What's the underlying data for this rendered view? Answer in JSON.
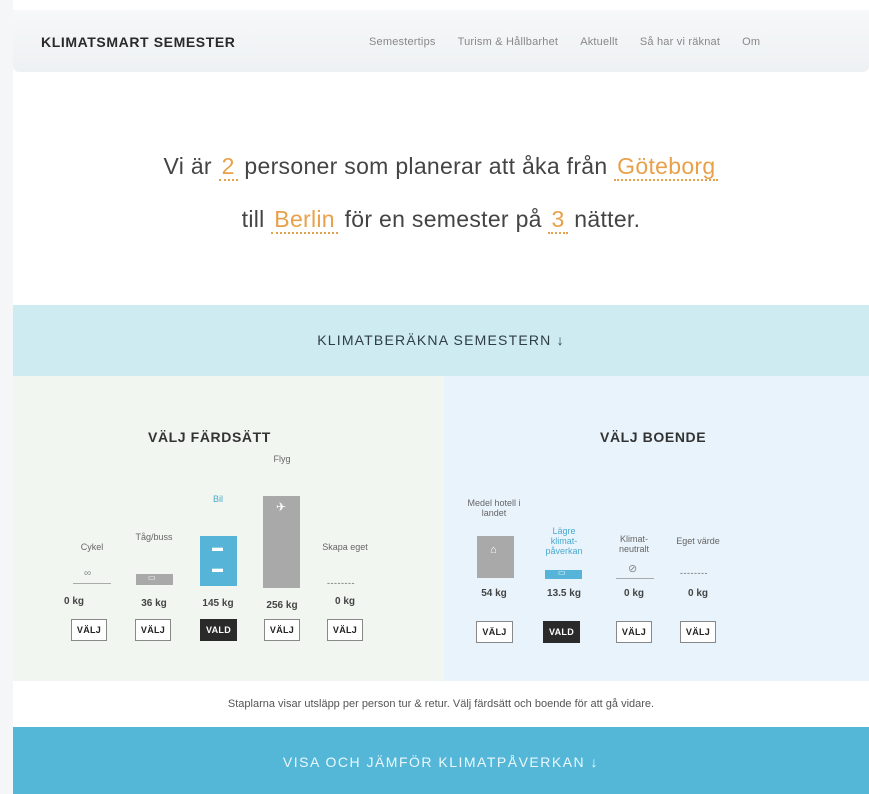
{
  "header": {
    "logo": "KLIMATSMART SEMESTER",
    "nav": [
      "Semestertips",
      "Turism & Hållbarhet",
      "Aktuellt",
      "Så har vi räknat",
      "Om"
    ]
  },
  "hero": {
    "part1": "Vi är",
    "persons": "2",
    "part2": "personer som planerar att åka från",
    "from": "Göteborg",
    "part3": "till",
    "to": "Berlin",
    "part4": "för en semester på",
    "nights": "3",
    "part5": "nätter."
  },
  "band": {
    "label": "KLIMATBERÄKNA SEMESTERN ↓"
  },
  "transport": {
    "title": "VÄLJ FÄRDSÄTT",
    "options": [
      {
        "label": "Cykel",
        "value": "0 kg",
        "button": "VÄLJ",
        "selected": false,
        "icon": "bicycle-icon"
      },
      {
        "label": "Tåg/buss",
        "value": "36 kg",
        "button": "VÄLJ",
        "selected": false,
        "icon": "train-icon"
      },
      {
        "label": "Bil",
        "value": "145 kg",
        "button": "VALD",
        "selected": true,
        "icon": "car-icon"
      },
      {
        "label": "Flyg",
        "value": "256 kg",
        "button": "VÄLJ",
        "selected": false,
        "icon": "plane-icon"
      },
      {
        "label": "Skapa eget",
        "value": "0 kg",
        "button": "VÄLJ",
        "selected": false,
        "dashes": "--------"
      }
    ]
  },
  "accommodation": {
    "title": "VÄLJ BOENDE",
    "options": [
      {
        "label": "Medel hotell i landet",
        "value": "54 kg",
        "button": "VÄLJ",
        "selected": false,
        "icon": "house-icon"
      },
      {
        "label": "Lägre klimat-påverkan",
        "value": "13.5 kg",
        "button": "VALD",
        "selected": true,
        "icon": "bed-icon"
      },
      {
        "label": "Klimat-neutralt",
        "value": "0 kg",
        "button": "VÄLJ",
        "selected": false,
        "icon": "zero-icon"
      },
      {
        "label": "Eget värde",
        "value": "0 kg",
        "button": "VÄLJ",
        "selected": false,
        "dashes": "--------"
      }
    ]
  },
  "footnote": "Staplarna visar utsläpp per person tur & retur. Välj färdsätt och boende för att gå vidare.",
  "cta": {
    "label": "VISA OCH JÄMFÖR KLIMATPÅVERKAN ↓"
  },
  "colors": {
    "accent_orange": "#e8a04a",
    "accent_blue": "#56b4d9",
    "band": "#cdebf0",
    "cta": "#55b7d8"
  }
}
